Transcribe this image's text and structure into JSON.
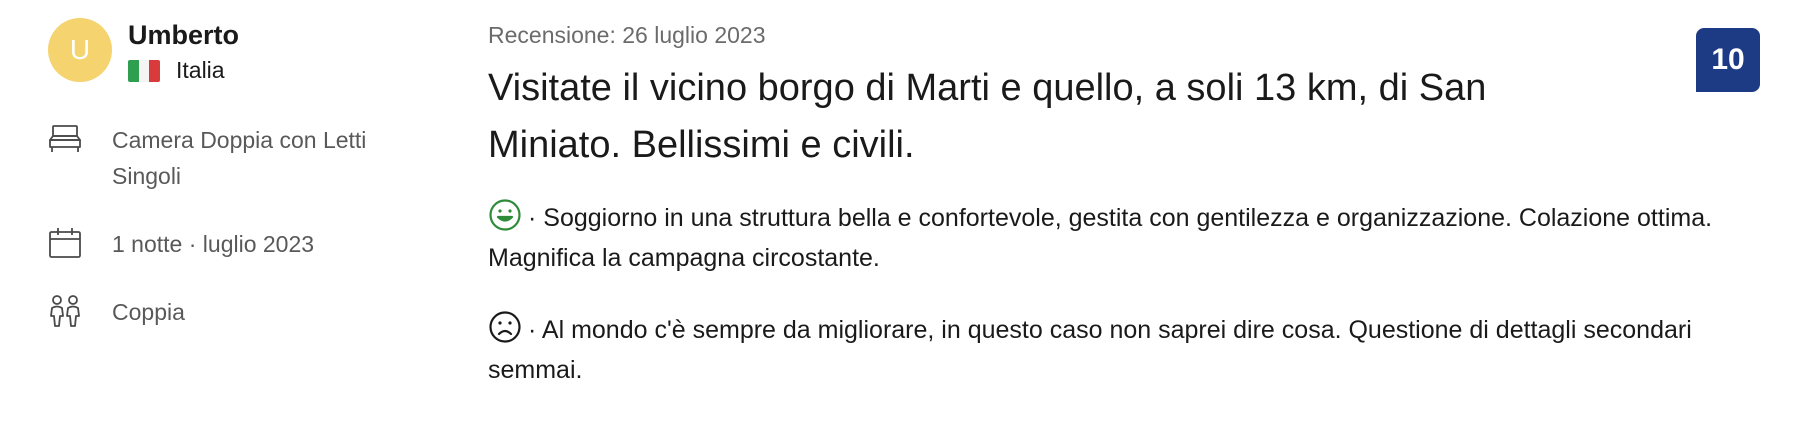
{
  "reviewer": {
    "avatar_letter": "U",
    "name": "Umberto",
    "country": "Italia",
    "avatar_color": "#f5d36e"
  },
  "details": {
    "room_type": "Camera Doppia con Letti Singoli",
    "nights": "1 notte",
    "separator": "·",
    "stay_date": "luglio 2023",
    "traveler_type": "Coppia"
  },
  "review": {
    "date": "Recensione: 26 luglio 2023",
    "title": "Visitate il vicino borgo di Marti e quello, a soli 13 km, di San Miniato. Bellissimi e civili.",
    "positive_prefix": "·",
    "positive": "Soggiorno in una struttura bella e confortevole, gestita con gentilezza e organizzazione. Colazione ottima. Magnifica la campagna circostante.",
    "negative_prefix": "·",
    "negative": "Al mondo c'è sempre da migliorare, in questo caso non saprei dire cosa. Questione di dettagli secondari semmai.",
    "score": "10",
    "score_color": "#1d3b84",
    "positive_icon": "smile-icon",
    "negative_icon": "frown-icon"
  }
}
